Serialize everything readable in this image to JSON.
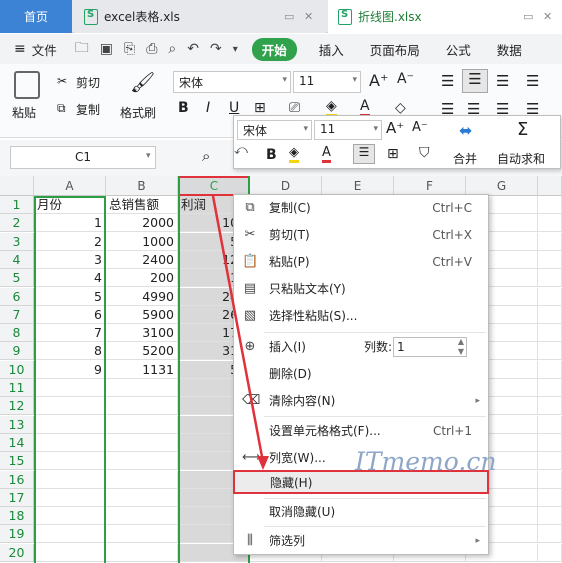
{
  "tabs": {
    "home": "首页",
    "file1": "excel表格.xls",
    "file2": "折线图.xlsx"
  },
  "menu": {
    "file": "文件",
    "start": "开始",
    "insert": "插入",
    "page_layout": "页面布局",
    "formula": "公式",
    "data": "数据"
  },
  "ribbon": {
    "paste": "粘贴",
    "cut": "剪切",
    "copy": "复制",
    "format_painter": "格式刷",
    "font_name": "宋体",
    "font_size": "11",
    "bold": "B",
    "italic": "I",
    "underline": "U"
  },
  "mini_toolbar": {
    "font_name": "宋体",
    "font_size": "11",
    "merge": "合并",
    "autosum": "自动求和"
  },
  "name_box": "C1",
  "columns": [
    "A",
    "B",
    "C",
    "D",
    "E",
    "F",
    "G"
  ],
  "rows": [
    "1",
    "2",
    "3",
    "4",
    "5",
    "6",
    "7",
    "8",
    "9",
    "10",
    "11",
    "12",
    "13",
    "14",
    "15",
    "16",
    "17",
    "18",
    "19",
    "20"
  ],
  "table": {
    "headers": [
      "月份",
      "总销售额",
      "利润"
    ],
    "A": [
      "1",
      "2",
      "3",
      "4",
      "5",
      "6",
      "7",
      "8",
      "9"
    ],
    "B": [
      "2000",
      "1000",
      "2400",
      "200",
      "4990",
      "5900",
      "3100",
      "5200",
      "1131"
    ],
    "C": [
      "100",
      "50",
      "120",
      "10",
      "245",
      "260",
      "170",
      "310",
      "50"
    ]
  },
  "context_menu": {
    "copy": {
      "label": "复制(C)",
      "shortcut": "Ctrl+C"
    },
    "cut": {
      "label": "剪切(T)",
      "shortcut": "Ctrl+X"
    },
    "paste": {
      "label": "粘贴(P)",
      "shortcut": "Ctrl+V"
    },
    "paste_text": {
      "label": "只粘贴文本(Y)"
    },
    "paste_special": {
      "label": "选择性粘贴(S)..."
    },
    "insert": {
      "label": "插入(I)",
      "cols_label": "列数:",
      "cols_value": "1"
    },
    "delete": {
      "label": "删除(D)"
    },
    "clear": {
      "label": "清除内容(N)"
    },
    "format_cells": {
      "label": "设置单元格格式(F)...",
      "shortcut": "Ctrl+1"
    },
    "col_width": {
      "label": "列宽(W)..."
    },
    "hide": {
      "label": "隐藏(H)"
    },
    "unhide": {
      "label": "取消隐藏(U)"
    },
    "filter": {
      "label": "筛选列"
    }
  },
  "watermark": "ITmemo.cn",
  "colors": {
    "tab_active": "#3c83d6",
    "start_green": "#2fa24b",
    "highlight_red": "#e0323b",
    "selection_green": "#2e9e44"
  }
}
